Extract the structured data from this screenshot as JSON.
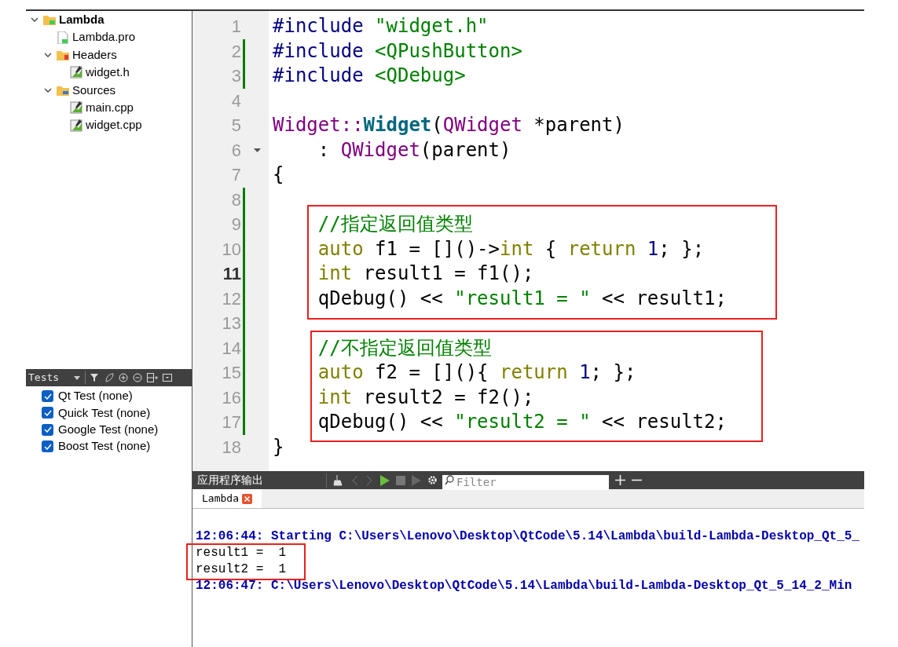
{
  "project_tree": [
    {
      "label": "Lambda",
      "kind": "project",
      "expanded": true,
      "children": [
        {
          "label": "Lambda.pro",
          "kind": "pro"
        },
        {
          "label": "Headers",
          "kind": "headers",
          "expanded": true,
          "children": [
            {
              "label": "widget.h",
              "kind": "file"
            }
          ]
        },
        {
          "label": "Sources",
          "kind": "sources",
          "expanded": true,
          "children": [
            {
              "label": "main.cpp",
              "kind": "file"
            },
            {
              "label": "widget.cpp",
              "kind": "file"
            }
          ]
        }
      ]
    }
  ],
  "tests_panel": {
    "title": "Tests",
    "items": [
      {
        "label": "Qt Test (none)",
        "checked": true
      },
      {
        "label": "Quick Test (none)",
        "checked": true
      },
      {
        "label": "Google Test (none)",
        "checked": true
      },
      {
        "label": "Boost Test (none)",
        "checked": true
      }
    ]
  },
  "editor": {
    "lines": [
      {
        "number": "1",
        "changed": false,
        "current": false,
        "foldable": false,
        "tokens": [
          {
            "kind": "preproc",
            "text": "#include "
          },
          {
            "kind": "string",
            "text": "\"widget.h\""
          }
        ]
      },
      {
        "number": "2",
        "changed": true,
        "current": false,
        "foldable": false,
        "tokens": [
          {
            "kind": "preproc",
            "text": "#include "
          },
          {
            "kind": "string",
            "text": "<QPushButton>"
          }
        ]
      },
      {
        "number": "3",
        "changed": true,
        "current": false,
        "foldable": false,
        "tokens": [
          {
            "kind": "preproc",
            "text": "#include "
          },
          {
            "kind": "string",
            "text": "<QDebug>"
          }
        ]
      },
      {
        "number": "4",
        "changed": false,
        "current": false,
        "foldable": false
      },
      {
        "number": "5",
        "changed": false,
        "current": false,
        "foldable": false,
        "tokens": [
          {
            "kind": "class",
            "text": "Widget::"
          },
          {
            "kind": "funcdecl",
            "text": "Widget"
          },
          {
            "kind": "plain",
            "text": "("
          },
          {
            "kind": "class",
            "text": "QWidget"
          },
          {
            "kind": "plain",
            "text": " *parent)"
          }
        ]
      },
      {
        "number": "6",
        "changed": false,
        "current": false,
        "foldable": true,
        "tokens": [
          {
            "kind": "plain",
            "text": "    : "
          },
          {
            "kind": "class",
            "text": "QWidget"
          },
          {
            "kind": "plain",
            "text": "(parent)"
          }
        ]
      },
      {
        "number": "7",
        "changed": false,
        "current": false,
        "foldable": false,
        "tokens": [
          {
            "kind": "plain",
            "text": "{"
          }
        ]
      },
      {
        "number": "8",
        "changed": true,
        "current": false,
        "foldable": false
      },
      {
        "number": "9",
        "changed": true,
        "current": false,
        "foldable": false,
        "tokens": [
          {
            "kind": "comment",
            "text": "    //指定返回值类型"
          }
        ]
      },
      {
        "number": "10",
        "changed": true,
        "current": false,
        "foldable": false,
        "tokens": [
          {
            "kind": "keyword",
            "text": "    auto"
          },
          {
            "kind": "plain",
            "text": " f1 = []()->"
          },
          {
            "kind": "keyword",
            "text": "int"
          },
          {
            "kind": "plain",
            "text": " { "
          },
          {
            "kind": "keyword",
            "text": "return"
          },
          {
            "kind": "number",
            "text": " 1"
          },
          {
            "kind": "plain",
            "text": "; };"
          }
        ]
      },
      {
        "number": "11",
        "changed": true,
        "current": true,
        "foldable": false,
        "tokens": [
          {
            "kind": "keyword",
            "text": "    int"
          },
          {
            "kind": "plain",
            "text": " result1 = f1();"
          }
        ]
      },
      {
        "number": "12",
        "changed": true,
        "current": false,
        "foldable": false,
        "tokens": [
          {
            "kind": "plain",
            "text": "    qDebug() << "
          },
          {
            "kind": "string",
            "text": "\"result1 = \""
          },
          {
            "kind": "plain",
            "text": " << result1;"
          }
        ]
      },
      {
        "number": "13",
        "changed": true,
        "current": false,
        "foldable": false
      },
      {
        "number": "14",
        "changed": true,
        "current": false,
        "foldable": false,
        "tokens": [
          {
            "kind": "comment",
            "text": "    //不指定返回值类型"
          }
        ]
      },
      {
        "number": "15",
        "changed": true,
        "current": false,
        "foldable": false,
        "tokens": [
          {
            "kind": "keyword",
            "text": "    auto"
          },
          {
            "kind": "plain",
            "text": " f2 = [](){ "
          },
          {
            "kind": "keyword",
            "text": "return"
          },
          {
            "kind": "number",
            "text": " 1"
          },
          {
            "kind": "plain",
            "text": "; };"
          }
        ]
      },
      {
        "number": "16",
        "changed": true,
        "current": false,
        "foldable": false,
        "tokens": [
          {
            "kind": "keyword",
            "text": "    int"
          },
          {
            "kind": "plain",
            "text": " result2 = f2();"
          }
        ]
      },
      {
        "number": "17",
        "changed": true,
        "current": false,
        "foldable": false,
        "tokens": [
          {
            "kind": "plain",
            "text": "    qDebug() << "
          },
          {
            "kind": "string",
            "text": "\"result2 = \""
          },
          {
            "kind": "plain",
            "text": " << result2;"
          }
        ]
      },
      {
        "number": "18",
        "changed": false,
        "current": false,
        "foldable": false,
        "tokens": [
          {
            "kind": "plain",
            "text": "}"
          }
        ]
      }
    ]
  },
  "output_pane": {
    "title": "应用程序输出",
    "filter": {
      "placeholder": "Filter"
    },
    "tabs": [
      {
        "label": "Lambda",
        "selected": true
      }
    ],
    "lines": [
      {
        "kind": "system",
        "text": "12:06:44: Starting C:\\Users\\Lenovo\\Desktop\\QtCode\\5.14\\Lambda\\build-Lambda-Desktop_Qt_5_"
      },
      {
        "kind": "stdout",
        "text": "result1 =  1"
      },
      {
        "kind": "stdout",
        "text": "result2 =  1"
      },
      {
        "kind": "system",
        "text": "12:06:47: C:\\Users\\Lenovo\\Desktop\\QtCode\\5.14\\Lambda\\build-Lambda-Desktop_Qt_5_14_2_Min"
      }
    ]
  }
}
